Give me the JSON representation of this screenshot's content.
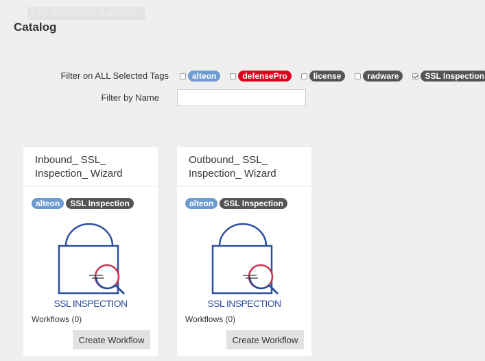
{
  "build": {
    "text": "4.5.0-SNAPSHOT Build 3264"
  },
  "page": {
    "title": "Catalog"
  },
  "filters": {
    "tags_label": "Filter on ALL Selected Tags",
    "name_label": "Filter by Name",
    "name_value": "",
    "tags": [
      {
        "label": "alteon",
        "checked": false,
        "color": "#6b9bd1"
      },
      {
        "label": "defensePro",
        "checked": false,
        "color": "#e0001b"
      },
      {
        "label": "license",
        "checked": false,
        "color": "#555555"
      },
      {
        "label": "radware",
        "checked": false,
        "color": "#555555"
      },
      {
        "label": "SSL Inspection",
        "checked": true,
        "color": "#555555"
      }
    ]
  },
  "cards": [
    {
      "title": "Inbound_ SSL_ Inspection_ Wizard",
      "tags": [
        "alteon",
        "SSL Inspection"
      ],
      "icon": "ssl-inspection-icon",
      "icon_text": "SSL INSPECTION",
      "workflows": "Workflows (0)",
      "button": "Create Workflow"
    },
    {
      "title": "Outbound_ SSL_ Inspection_ Wizard",
      "tags": [
        "alteon",
        "SSL Inspection"
      ],
      "icon": "ssl-inspection-icon",
      "icon_text": "SSL INSPECTION",
      "workflows": "Workflows (0)",
      "button": "Create Workflow"
    }
  ],
  "colors": {
    "alteon": "#6b9bd1",
    "defensePro": "#e0001b",
    "dark_tag": "#555555",
    "icon_blue": "#2b4f9e",
    "icon_red": "#c8314a"
  }
}
